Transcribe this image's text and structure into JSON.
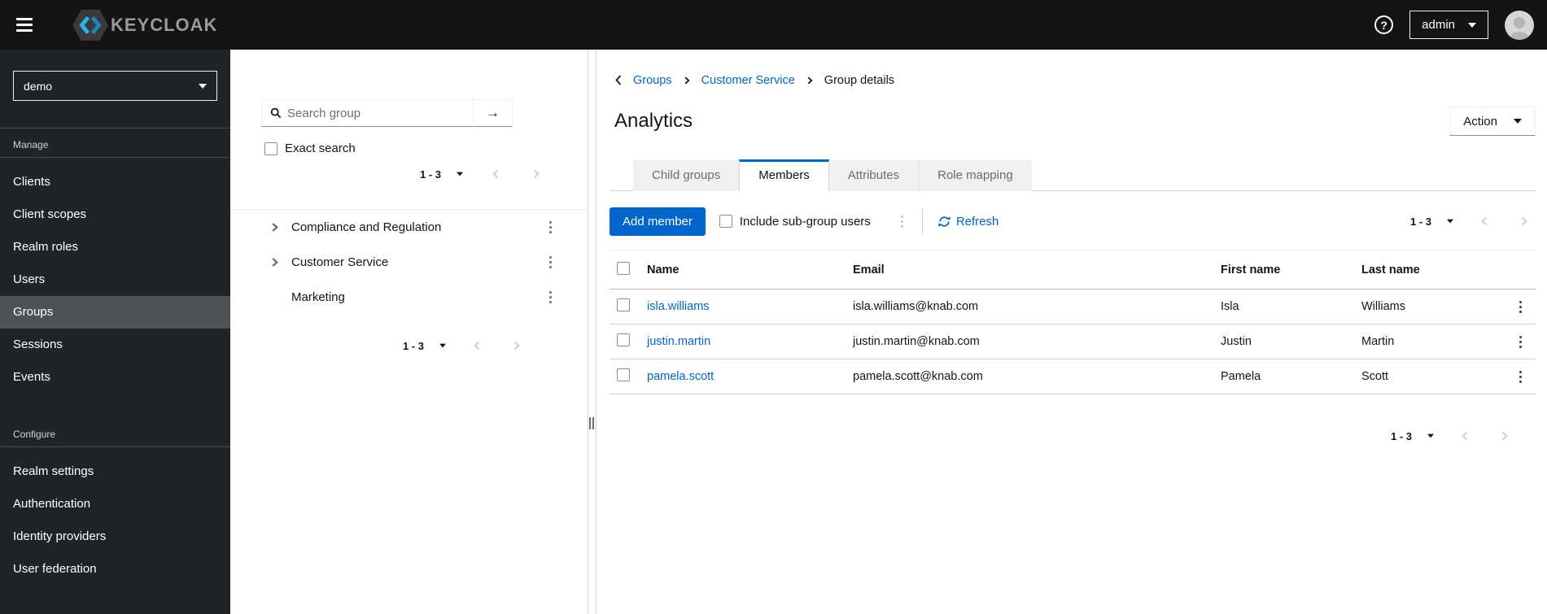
{
  "colors": {
    "accent": "#0066cc",
    "topbar_bg": "#141414",
    "sidebar_bg": "#212427",
    "sidebar_active_bg": "#4f5255",
    "tab_inactive_bg": "#f0f0f0",
    "muted_text": "#6a6e73",
    "border": "#d2d2d2"
  },
  "topbar": {
    "brand": "KEYCLOAK",
    "help_glyph": "?",
    "user_menu": "admin"
  },
  "sidebar": {
    "realm": "demo",
    "manage": {
      "label": "Manage",
      "items": [
        "Clients",
        "Client scopes",
        "Realm roles",
        "Users",
        "Groups",
        "Sessions",
        "Events"
      ],
      "active_item": "Groups"
    },
    "configure": {
      "label": "Configure",
      "items": [
        "Realm settings",
        "Authentication",
        "Identity providers",
        "User federation"
      ]
    }
  },
  "middle": {
    "search_placeholder": "Search group",
    "search_button_glyph": "→",
    "exact_search_label": "Exact search",
    "pagination_top": "1 - 3",
    "pagination_bottom": "1 - 3",
    "tree": [
      {
        "label": "Compliance and Regulation"
      },
      {
        "label": "Customer Service"
      },
      {
        "label": "Marketing"
      }
    ]
  },
  "main": {
    "breadcrumb": {
      "items": [
        "Groups",
        "Customer Service",
        "Group details"
      ]
    },
    "title": "Analytics",
    "action_label": "Action",
    "tabs": [
      "Child groups",
      "Members",
      "Attributes",
      "Role mapping"
    ],
    "active_tab": "Members",
    "toolbar": {
      "add_member_label": "Add member",
      "include_label": "Include sub-group users",
      "refresh_label": "Refresh",
      "pagination": "1 - 3"
    },
    "table": {
      "headers": [
        "Name",
        "Email",
        "First name",
        "Last name"
      ],
      "rows": [
        {
          "username": "isla.williams",
          "email": "isla.williams@knab.com",
          "first": "Isla",
          "last": "Williams"
        },
        {
          "username": "justin.martin",
          "email": "justin.martin@knab.com",
          "first": "Justin",
          "last": "Martin"
        },
        {
          "username": "pamela.scott",
          "email": "pamela.scott@knab.com",
          "first": "Pamela",
          "last": "Scott"
        }
      ]
    },
    "table_pagination": "1 - 3"
  }
}
